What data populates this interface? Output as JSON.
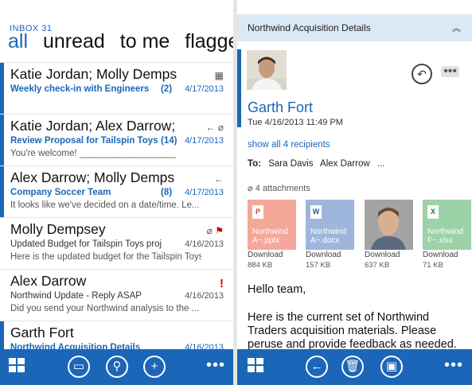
{
  "left": {
    "folder_label": "INBOX 31",
    "pivots": [
      "all",
      "unread",
      "to me",
      "flagged"
    ],
    "messages": [
      {
        "from": "Katie Jordan; Molly Demps",
        "subject": "Weekly check-in with Engineers",
        "count": "(2)",
        "date": "4/17/2013",
        "preview": "",
        "icons": "▦"
      },
      {
        "from": "Katie Jordan; Alex Darrow;",
        "subject": "Review Proposal for Tailspin Toys",
        "count": "(14)",
        "date": "4/17/2013",
        "preview": "You're welcome! ___________________",
        "icons": "← ⌀"
      },
      {
        "from": "Alex Darrow; Molly Demps",
        "subject": "Company Soccer Team",
        "count": "(8)",
        "date": "4/17/2013",
        "preview": "It looks like we've decided on a date/time.  Le...",
        "icons": "←"
      },
      {
        "from": "Molly Dempsey",
        "subject": "Updated Budget for Tailspin Toys project",
        "count": "",
        "date": "4/16/2013",
        "preview": "Here is the updated budget for the Tailspin Toys",
        "icons": "⌀ ⚑"
      },
      {
        "from": "Alex Darrow",
        "subject": "Northwind Update - Reply ASAP",
        "count": "",
        "date": "4/16/2013",
        "preview": "Did you send your Northwind analysis to the ...",
        "icons": "!"
      },
      {
        "from": "Garth Fort",
        "subject": "Northwind Acquisition Details",
        "count": "",
        "date": "4/16/2013",
        "preview": "",
        "icons": ""
      }
    ]
  },
  "right": {
    "header_title": "Northwind Acquisition Details",
    "sender": "Garth Fort",
    "sent": "Tue 4/16/2013 11:49 PM",
    "show_all": "show all 4 recipients",
    "to_label": "To:",
    "recipients": [
      "Sara Davis",
      "Alex Darrow",
      "..."
    ],
    "attachments_label": "4 attachments",
    "attachments": [
      {
        "name": "Northwind A~.pptx",
        "size": "884 KB",
        "action": "Download",
        "color": "#f4a89a",
        "glyph": "P"
      },
      {
        "name": "Northwind A~.docx",
        "size": "157 KB",
        "action": "Download",
        "color": "#9fb6dc",
        "glyph": "W"
      },
      {
        "name": "",
        "size": "637 KB",
        "action": "Download",
        "color": "#9a9a9a",
        "glyph": ""
      },
      {
        "name": "Northwind F~.xlsx",
        "size": "71 KB",
        "action": "Download",
        "color": "#9dd1a8",
        "glyph": "X"
      }
    ],
    "body": [
      "Hello team,",
      "Here is the current set of Northwind Traders acquisition materials.  Please peruse and provide feedback as needed."
    ]
  },
  "colors": {
    "accent": "#1b66b8"
  }
}
